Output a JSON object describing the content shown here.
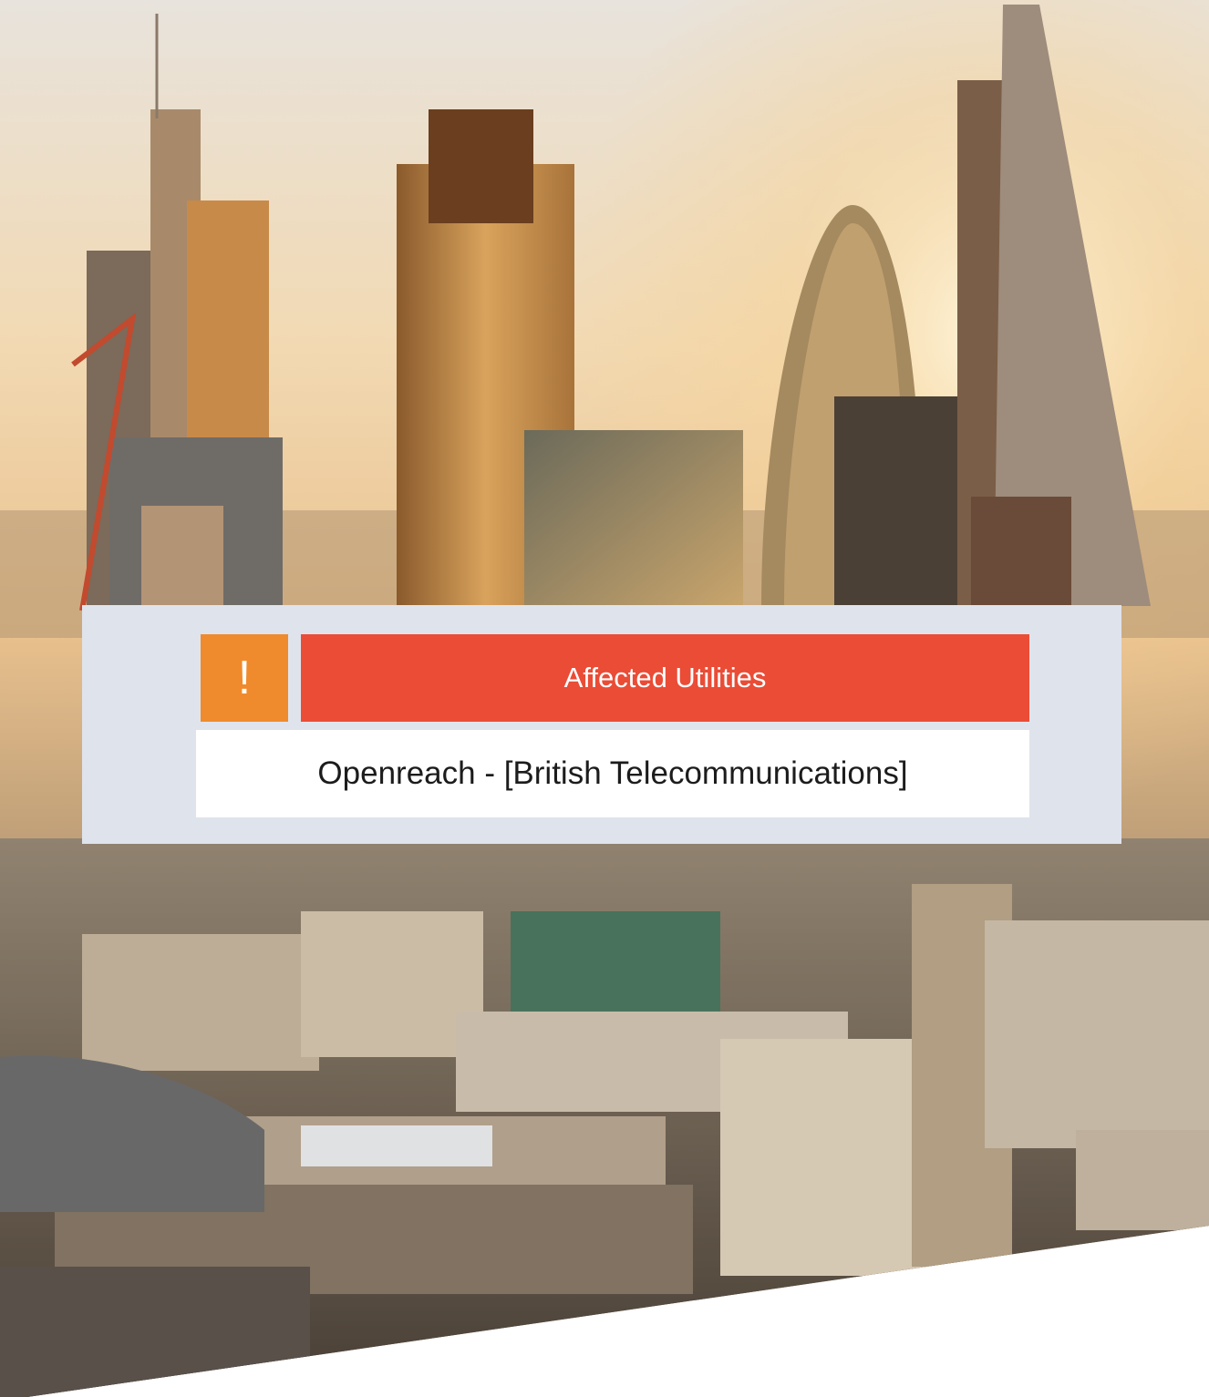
{
  "alert": {
    "symbol": "!",
    "icon": "exclamation-icon"
  },
  "header": {
    "title": "Affected Utilities"
  },
  "utilities": [
    "Openreach - [British Telecommunications]"
  ],
  "colors": {
    "panel": "#dfe3ec",
    "icon_bg": "#ef8b2c",
    "header_bg": "#ea4c36",
    "item_bg": "#ffffff"
  }
}
